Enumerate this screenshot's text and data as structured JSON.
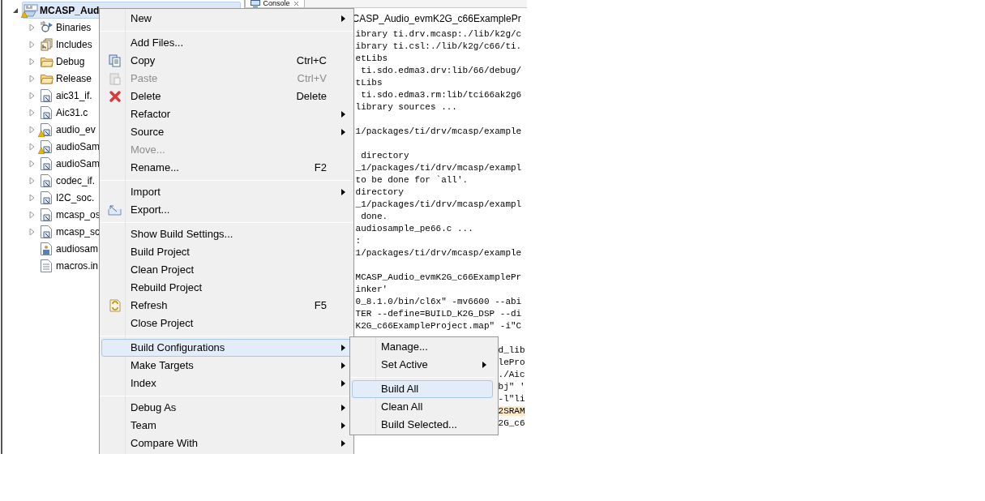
{
  "project_tree": {
    "project": {
      "label": "MCASP_Aud",
      "expanded": true,
      "selected": true,
      "warning": true
    },
    "children": [
      {
        "label": "Binaries",
        "kind": "binaries",
        "expandable": true,
        "warning": false
      },
      {
        "label": "Includes",
        "kind": "includes",
        "expandable": true,
        "warning": false
      },
      {
        "label": "Debug",
        "kind": "folder",
        "expandable": true,
        "warning": false
      },
      {
        "label": "Release",
        "kind": "folder",
        "expandable": true,
        "warning": false
      },
      {
        "label": "aic31_if.",
        "kind": "source",
        "expandable": true,
        "warning": false
      },
      {
        "label": "Aic31.c",
        "kind": "source",
        "expandable": true,
        "warning": false
      },
      {
        "label": "audio_ev",
        "kind": "source",
        "expandable": true,
        "warning": true
      },
      {
        "label": "audioSam",
        "kind": "source",
        "expandable": true,
        "warning": true
      },
      {
        "label": "audioSam",
        "kind": "source",
        "expandable": true,
        "warning": false
      },
      {
        "label": "codec_if.",
        "kind": "source",
        "expandable": true,
        "warning": false
      },
      {
        "label": "I2C_soc.",
        "kind": "source",
        "expandable": true,
        "warning": false
      },
      {
        "label": "mcasp_os",
        "kind": "source",
        "expandable": true,
        "warning": false
      },
      {
        "label": "mcasp_sc",
        "kind": "source",
        "expandable": true,
        "warning": false
      },
      {
        "label": "audiosam",
        "kind": "config",
        "expandable": false,
        "warning": false
      },
      {
        "label": "macros.in",
        "kind": "text",
        "expandable": false,
        "warning": false
      }
    ]
  },
  "console": {
    "tab": "Console",
    "title": "CASP_Audio_evmK2G_c66ExamplePr",
    "lines": [
      {
        "kind": "full",
        "text": "ibrary ti.drv.mcasp:./lib/k2g/c"
      },
      {
        "kind": "full",
        "text": "ibrary ti.csl:./lib/k2g/c66/ti."
      },
      {
        "kind": "full",
        "text": "etLibs"
      },
      {
        "kind": "full",
        "text": " ti.sdo.edma3.drv:lib/66/debug/"
      },
      {
        "kind": "full",
        "text": "tLibs"
      },
      {
        "kind": "full",
        "text": " ti.sdo.edma3.rm:lib/tci66ak2g6"
      },
      {
        "kind": "full",
        "text": "library sources ..."
      },
      {
        "kind": "blank"
      },
      {
        "kind": "full",
        "text": "1/packages/ti/drv/mcasp/example"
      },
      {
        "kind": "blank"
      },
      {
        "kind": "full",
        "text": " directory"
      },
      {
        "kind": "full",
        "text": "_1/packages/ti/drv/mcasp/exampl"
      },
      {
        "kind": "full",
        "text": "to be done for `all'."
      },
      {
        "kind": "full",
        "text": "directory"
      },
      {
        "kind": "full",
        "text": "_1/packages/ti/drv/mcasp/exampl"
      },
      {
        "kind": "full",
        "text": " done."
      },
      {
        "kind": "full",
        "text": "audiosample_pe66.c ..."
      },
      {
        "kind": "full",
        "text": ":"
      },
      {
        "kind": "full",
        "text": "1/packages/ti/drv/mcasp/example"
      },
      {
        "kind": "blank"
      },
      {
        "kind": "full",
        "text": "MCASP_Audio_evmK2G_c66ExamplePr"
      },
      {
        "kind": "full",
        "text": "inker'"
      },
      {
        "kind": "full",
        "text": "0_8.1.0/bin/cl6x\" -mv6600 --abi"
      },
      {
        "kind": "full",
        "text": "TER --define=BUILD_K2G_DSP --di"
      },
      {
        "kind": "full",
        "text": "K2G_c66ExampleProject.map\" -i\"C"
      },
      {
        "kind": "blank"
      },
      {
        "kind": "tail",
        "text": "d_lib",
        "highlighted": false
      },
      {
        "kind": "tail",
        "text": "lePro",
        "highlighted": false
      },
      {
        "kind": "tail",
        "text": "./Aic",
        "highlighted": false
      },
      {
        "kind": "tail",
        "text": "bj\" '",
        "highlighted": false
      },
      {
        "kind": "tail",
        "text": "-l\"li",
        "highlighted": false
      },
      {
        "kind": "tail",
        "text": "2SRAM",
        "highlighted": true
      },
      {
        "kind": "tail",
        "text": "2G_c6",
        "highlighted": false
      }
    ]
  },
  "context_menu": {
    "sections": [
      [
        {
          "label": "New",
          "submenu": true,
          "disabled": false,
          "selected": false
        }
      ],
      [
        {
          "label": "Add Files...",
          "submenu": false,
          "disabled": false,
          "selected": false
        },
        {
          "label": "Copy",
          "shortcut": "Ctrl+C",
          "kind": "copy",
          "submenu": false,
          "disabled": false,
          "selected": false
        },
        {
          "label": "Paste",
          "shortcut": "Ctrl+V",
          "kind": "paste",
          "submenu": false,
          "disabled": true,
          "selected": false
        },
        {
          "label": "Delete",
          "shortcut": "Delete",
          "kind": "delete",
          "submenu": false,
          "disabled": false,
          "selected": false
        },
        {
          "label": "Refactor",
          "submenu": true,
          "disabled": false,
          "selected": false
        },
        {
          "label": "Source",
          "submenu": true,
          "disabled": false,
          "selected": false
        },
        {
          "label": "Move...",
          "submenu": false,
          "disabled": true,
          "selected": false
        },
        {
          "label": "Rename...",
          "shortcut": "F2",
          "submenu": false,
          "disabled": false,
          "selected": false
        }
      ],
      [
        {
          "label": "Import",
          "submenu": true,
          "disabled": false,
          "selected": false
        },
        {
          "label": "Export...",
          "kind": "export",
          "submenu": false,
          "disabled": false,
          "selected": false
        }
      ],
      [
        {
          "label": "Show Build Settings...",
          "submenu": false,
          "disabled": false,
          "selected": false
        },
        {
          "label": "Build Project",
          "submenu": false,
          "disabled": false,
          "selected": false
        },
        {
          "label": "Clean Project",
          "submenu": false,
          "disabled": false,
          "selected": false
        },
        {
          "label": "Rebuild Project",
          "submenu": false,
          "disabled": false,
          "selected": false
        },
        {
          "label": "Refresh",
          "shortcut": "F5",
          "kind": "refresh",
          "submenu": false,
          "disabled": false,
          "selected": false
        },
        {
          "label": "Close Project",
          "submenu": false,
          "disabled": false,
          "selected": false
        }
      ],
      [
        {
          "label": "Build Configurations",
          "submenu": true,
          "disabled": false,
          "selected": true
        },
        {
          "label": "Make Targets",
          "submenu": true,
          "disabled": false,
          "selected": false
        },
        {
          "label": "Index",
          "submenu": true,
          "disabled": false,
          "selected": false
        }
      ],
      [
        {
          "label": "Debug As",
          "submenu": true,
          "disabled": false,
          "selected": false
        },
        {
          "label": "Team",
          "submenu": true,
          "disabled": false,
          "selected": false
        },
        {
          "label": "Compare With",
          "submenu": true,
          "disabled": false,
          "selected": false
        }
      ]
    ]
  },
  "submenu": {
    "sections": [
      [
        {
          "label": "Manage...",
          "submenu": false,
          "selected": false
        },
        {
          "label": "Set Active",
          "submenu": true,
          "selected": false
        }
      ],
      [
        {
          "label": "Build All",
          "submenu": false,
          "selected": true
        },
        {
          "label": "Clean All",
          "submenu": false,
          "selected": false
        },
        {
          "label": "Build Selected...",
          "submenu": false,
          "selected": false
        }
      ]
    ]
  }
}
